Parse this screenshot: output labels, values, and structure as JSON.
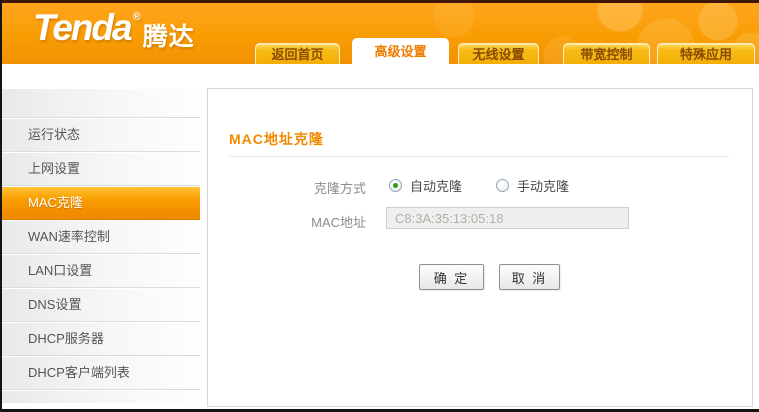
{
  "header": {
    "logo_en": "Tenda",
    "logo_reg": "®",
    "logo_cn": "腾达",
    "tabs": [
      {
        "label": "返回首页",
        "active": false
      },
      {
        "label": "高级设置",
        "active": true
      },
      {
        "label": "无线设置",
        "active": false
      },
      {
        "label": "带宽控制",
        "active": false
      },
      {
        "label": "特殊应用",
        "active": false
      }
    ]
  },
  "sidebar": {
    "items": [
      {
        "label": "运行状态",
        "active": false
      },
      {
        "label": "上网设置",
        "active": false
      },
      {
        "label": "MAC克隆",
        "active": true
      },
      {
        "label": "WAN速率控制",
        "active": false
      },
      {
        "label": "LAN口设置",
        "active": false
      },
      {
        "label": "DNS设置",
        "active": false
      },
      {
        "label": "DHCP服务器",
        "active": false
      },
      {
        "label": "DHCP客户端列表",
        "active": false
      }
    ]
  },
  "main": {
    "title": "MAC地址克隆",
    "clone_mode_label": "克隆方式",
    "radio_auto_label": "自动克隆",
    "radio_manual_label": "手动克隆",
    "selected_mode": "自动克隆",
    "mac_label": "MAC地址",
    "mac_value": "C8:3A:35:13:05:18",
    "ok_label": "确 定",
    "cancel_label": "取 消"
  },
  "colors": {
    "header_orange": "#F89D04",
    "tab_gold": "#F5B519",
    "tab_text_brown": "#8A4A00",
    "active_tab_text": "#F07D00",
    "title_orange": "#F08A00",
    "sidebar_active_orange": "#F99E00",
    "radio_selected_green": "#2F9B1F"
  }
}
